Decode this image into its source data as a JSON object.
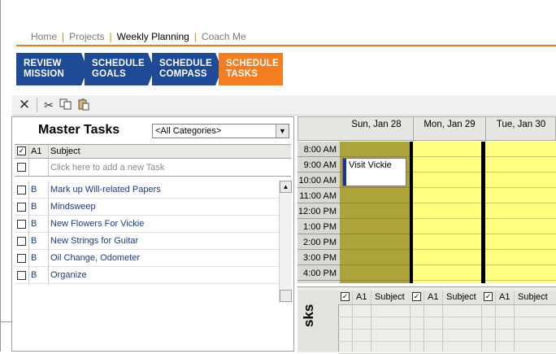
{
  "nav": {
    "home": "Home",
    "projects": "Projects",
    "weekly": "Weekly Planning",
    "coach": "Coach Me",
    "sep": "|"
  },
  "wizard": [
    {
      "line1": "REVIEW",
      "line2": "MISSION"
    },
    {
      "line1": "SCHEDULE",
      "line2": "GOALS"
    },
    {
      "line1": "SCHEDULE",
      "line2": "COMPASS"
    },
    {
      "line1": "SCHEDULE",
      "line2": "TASKS"
    }
  ],
  "toolbar": {
    "delete_icon": "close-icon",
    "cut_icon": "cut-icon",
    "copy_icon": "copy-icon",
    "paste_icon": "paste-icon"
  },
  "master": {
    "title": "Master Tasks",
    "category": "<All Categories>",
    "columns": {
      "priority": "A1",
      "subject": "Subject"
    },
    "new_task_placeholder": "Click here to add a new Task",
    "tasks": [
      {
        "priority": "B",
        "subject": "Mark up Will-related Papers"
      },
      {
        "priority": "B",
        "subject": "Mindsweep"
      },
      {
        "priority": "B",
        "subject": "New Flowers For Vickie"
      },
      {
        "priority": "B",
        "subject": "New Strings for Guitar"
      },
      {
        "priority": "B",
        "subject": "Oil Change, Odometer"
      },
      {
        "priority": "B",
        "subject": "Organize"
      }
    ]
  },
  "calendar": {
    "days": [
      "Sun, Jan 28",
      "Mon, Jan 29",
      "Tue, Jan 30"
    ],
    "times": [
      "8:00 AM",
      "9:00 AM",
      "10:00 AM",
      "11:00 AM",
      "12:00 PM",
      "1:00 PM",
      "2:00 PM",
      "3:00 PM",
      "4:00 PM"
    ],
    "appointment": "Visit Vickie",
    "colors": {
      "sunday": "#aca43a",
      "weekday": "#ffff80",
      "appointment_bar": "#1c2ea4"
    }
  },
  "day_tasks": {
    "columns": {
      "priority": "A1",
      "subject": "Subject"
    },
    "side_label": "sks"
  },
  "accent": {
    "orange": "#f47d20",
    "blue": "#1f4a96"
  }
}
